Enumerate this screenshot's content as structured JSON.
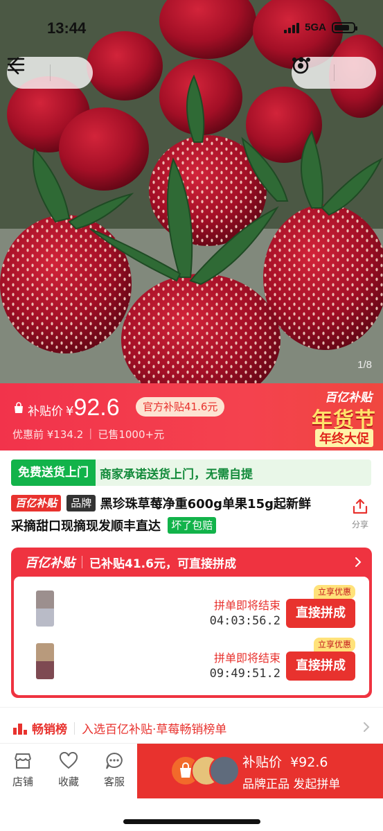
{
  "status_bar": {
    "time": "13:44",
    "network": "5GA"
  },
  "hero": {
    "image_counter": "1/8",
    "subject": "strawberries photo"
  },
  "nav": {
    "back_icon": "back-chevron-icon",
    "menu_icon": "hamburger-menu-icon",
    "more_icon": "more-dots-icon",
    "close_icon": "target-close-icon"
  },
  "price": {
    "label": "补贴价",
    "currency": "¥",
    "value": "92.6",
    "subsidy_tag": "官方补贴41.6元",
    "original": "优惠前 ¥134.2",
    "sold": "已售1000+元"
  },
  "promo": {
    "line1": "百亿补贴",
    "line2": "年货节",
    "line3": "年终大促"
  },
  "delivery": {
    "tag": "免费送货上门",
    "text": "商家承诺送货上门，无需自提"
  },
  "title": {
    "badge_subsidy": "百亿补贴",
    "badge_brand": "品牌",
    "text": "黑珍珠草莓净重600g单果15g起新鲜采摘甜口现摘现发顺丰直达",
    "badge_guarantee": "坏了包赔"
  },
  "share": {
    "label": "分享"
  },
  "group_buy": {
    "logo": "百亿补贴",
    "headline": "已补贴41.6元，可直接拼成",
    "rows": [
      {
        "status": "拼单即将结束",
        "timer": "04:03:56.2",
        "button": "直接拼成",
        "flag": "立享优惠",
        "avatar_colors": [
          "#9c8f8e",
          "#b9bbc7"
        ]
      },
      {
        "status": "拼单即将结束",
        "timer": "09:49:51.2",
        "button": "直接拼成",
        "flag": "立享优惠",
        "avatar_colors": [
          "#b89a7c",
          "#7e4a52"
        ]
      }
    ]
  },
  "ranking": {
    "label": "畅销榜",
    "text": "入选百亿补贴·草莓畅销榜单"
  },
  "bottom_bar": {
    "shop": "店铺",
    "favorite": "收藏",
    "service": "客服",
    "buy_price_label": "补贴价",
    "buy_price": "¥92.6",
    "buy_sub": "品牌正品 发起拼单"
  },
  "colors": {
    "accent": "#e8322e",
    "green": "#12b34a",
    "banner": "#f2334b"
  }
}
